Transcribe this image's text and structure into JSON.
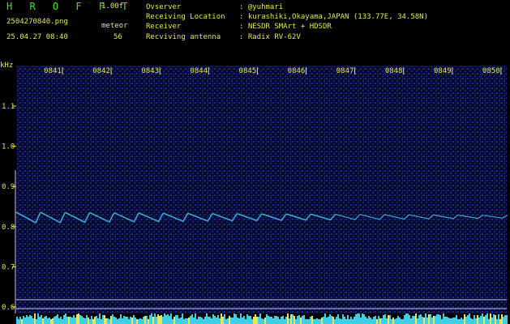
{
  "header": {
    "brand": "H R O F F T",
    "version": "1.00f",
    "filename": "2504270840.png",
    "meteor_label": "meteor",
    "datetime": "25.04.27 08:40",
    "meteor_count": "56"
  },
  "info": [
    {
      "key": "Ovserver",
      "value": ": @yuhmari"
    },
    {
      "key": "Receiving Location",
      "value": ": kurashiki,Okayama,JAPAN (133.77E, 34.58N)"
    },
    {
      "key": "Receiver",
      "value": ": NESDR SMArt + HDSDR"
    },
    {
      "key": "Recviving antenna",
      "value": ": Radix RV-62V"
    }
  ],
  "axis": {
    "unit": "kHz",
    "y_ticks": [
      "1.1",
      "1.0",
      "0.9",
      "0.8",
      "0.7",
      "0.6"
    ],
    "x_ticks": [
      "0841",
      "0842",
      "0843",
      "0844",
      "0845",
      "0846",
      "0847",
      "0848",
      "0849",
      "0850"
    ]
  },
  "colors": {
    "background": "#000000",
    "text": "#e6e65a",
    "brand": "#39e639",
    "noise": "#1a2c8c",
    "signal": "#3fc4e0",
    "reference_line": "#c8c8ff"
  }
}
